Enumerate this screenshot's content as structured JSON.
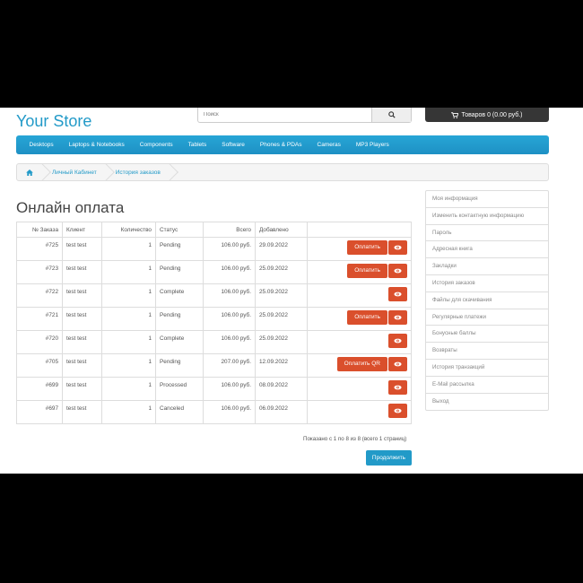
{
  "header": {
    "logo": "Your Store",
    "search_placeholder": "Поиск",
    "cart_label": "Товаров 0 (0.00 руб.)"
  },
  "menu": [
    "Desktops",
    "Laptops & Notebooks",
    "Components",
    "Tablets",
    "Software",
    "Phones & PDAs",
    "Cameras",
    "MP3 Players"
  ],
  "breadcrumb": [
    "Личный Кабинет",
    "История заказов"
  ],
  "page_title": "Онлайн оплата",
  "table": {
    "headers": [
      "№ Заказа",
      "Клиент",
      "Количество",
      "Статус",
      "Всего",
      "Добавлено",
      ""
    ],
    "rows": [
      {
        "id": "#725",
        "client": "test test",
        "qty": "1",
        "status": "Pending",
        "total": "106.00 руб.",
        "date": "29.09.2022",
        "pay": "Оплатить"
      },
      {
        "id": "#723",
        "client": "test test",
        "qty": "1",
        "status": "Pending",
        "total": "106.00 руб.",
        "date": "25.09.2022",
        "pay": "Оплатить"
      },
      {
        "id": "#722",
        "client": "test test",
        "qty": "1",
        "status": "Complete",
        "total": "106.00 руб.",
        "date": "25.09.2022",
        "pay": ""
      },
      {
        "id": "#721",
        "client": "test test",
        "qty": "1",
        "status": "Pending",
        "total": "106.00 руб.",
        "date": "25.09.2022",
        "pay": "Оплатить"
      },
      {
        "id": "#720",
        "client": "test test",
        "qty": "1",
        "status": "Complete",
        "total": "106.00 руб.",
        "date": "25.09.2022",
        "pay": ""
      },
      {
        "id": "#705",
        "client": "test test",
        "qty": "1",
        "status": "Pending",
        "total": "207.00 руб.",
        "date": "12.09.2022",
        "pay": "Оплатить QR"
      },
      {
        "id": "#699",
        "client": "test test",
        "qty": "1",
        "status": "Processed",
        "total": "106.00 руб.",
        "date": "08.09.2022",
        "pay": ""
      },
      {
        "id": "#697",
        "client": "test test",
        "qty": "1",
        "status": "Canceled",
        "total": "106.00 руб.",
        "date": "06.09.2022",
        "pay": ""
      }
    ]
  },
  "pagination_text": "Показано с 1 по 8 из 8 (всего 1 страниц)",
  "continue_label": "Продолжить",
  "sidebar": [
    "Моя информация",
    "Изменить контактную информацию",
    "Пароль",
    "Адресная книга",
    "Закладки",
    "История заказов",
    "Файлы для скачивания",
    "Регулярные платежи",
    "Бонусные баллы",
    "Возвраты",
    "История транзакций",
    "E-Mail рассылка",
    "Выход"
  ],
  "colors": {
    "accent": "#229ac8",
    "action": "#da4f2c",
    "cart": "#363636"
  },
  "icons": {
    "search": "search-icon",
    "cart": "cart-icon",
    "home": "home-icon",
    "view": "eye-icon"
  }
}
